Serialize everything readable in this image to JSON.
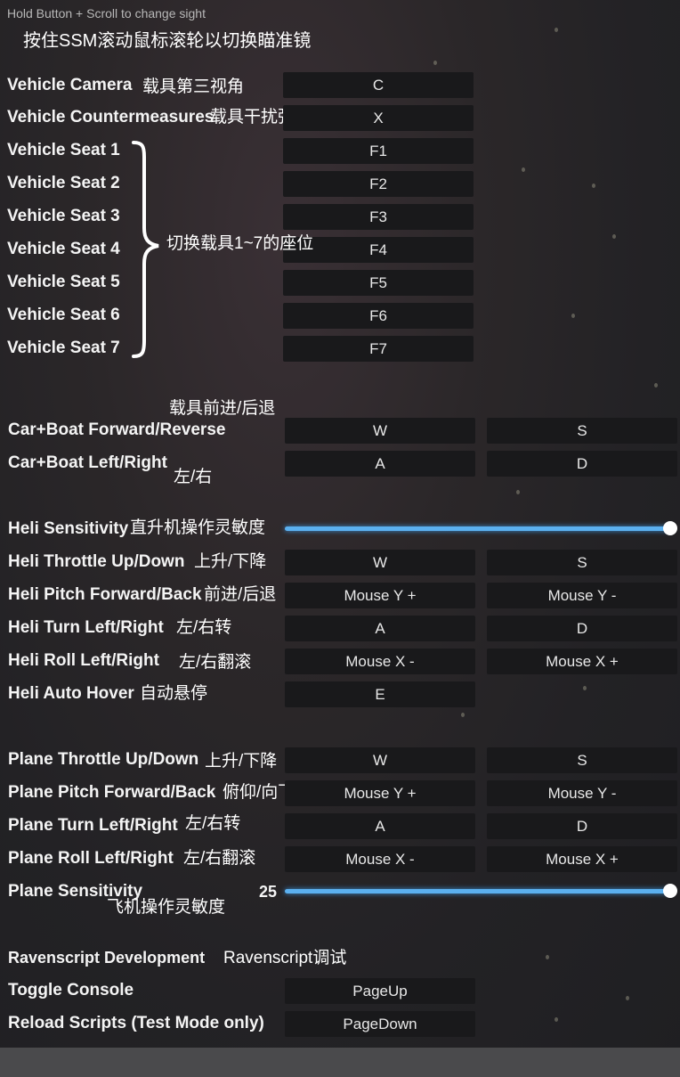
{
  "header": {
    "hint": "Hold Button + Scroll to change sight",
    "note_cn": "按住SSM滚动鼠标滚轮以切换瞄准镜"
  },
  "vehicle": {
    "camera_label": "Vehicle Camera",
    "camera_cn": "载具第三视角",
    "camera_key": "C",
    "counter_label": "Vehicle Countermeasures",
    "counter_cn": "载具干扰弹",
    "counter_key": "X",
    "seats": [
      {
        "label": "Vehicle Seat 1",
        "key": "F1"
      },
      {
        "label": "Vehicle Seat 2",
        "key": "F2"
      },
      {
        "label": "Vehicle Seat 3",
        "key": "F3"
      },
      {
        "label": "Vehicle Seat 4",
        "key": "F4"
      },
      {
        "label": "Vehicle Seat 5",
        "key": "F5"
      },
      {
        "label": "Vehicle Seat 6",
        "key": "F6"
      },
      {
        "label": "Vehicle Seat 7",
        "key": "F7"
      }
    ],
    "seats_cn": "切换载具1~7的座位"
  },
  "car": {
    "section_cn": "载具前进/后退",
    "forward_label": "Car+Boat Forward/Reverse",
    "forward_key1": "W",
    "forward_key2": "S",
    "left_label": "Car+Boat Left/Right",
    "left_cn": "左/右",
    "left_key1": "A",
    "left_key2": "D"
  },
  "heli": {
    "sensitivity_label": "Heli Sensitivity",
    "sensitivity_cn": "直升机操作灵敏度",
    "sensitivity_level": 1.0,
    "throttle_label": "Heli Throttle Up/Down",
    "throttle_cn": "上升/下降",
    "throttle_key1": "W",
    "throttle_key2": "S",
    "pitch_label": "Heli Pitch Forward/Back",
    "pitch_cn": "前进/后退",
    "pitch_key1": "Mouse Y +",
    "pitch_key2": "Mouse Y -",
    "turn_label": "Heli Turn Left/Right",
    "turn_cn": "左/右转",
    "turn_key1": "A",
    "turn_key2": "D",
    "roll_label": "Heli Roll Left/Right",
    "roll_cn": "左/右翻滚",
    "roll_key1": "Mouse X -",
    "roll_key2": "Mouse X +",
    "hover_label": "Heli Auto Hover",
    "hover_cn": "自动悬停",
    "hover_key": "E"
  },
  "plane": {
    "throttle_label": "Plane Throttle Up/Down",
    "throttle_cn": "上升/下降",
    "throttle_key1": "W",
    "throttle_key2": "S",
    "pitch_label": "Plane Pitch Forward/Back",
    "pitch_cn": "俯仰/向下",
    "pitch_key1": "Mouse Y +",
    "pitch_key2": "Mouse Y -",
    "turn_label": "Plane Turn Left/Right",
    "turn_cn": "左/右转",
    "turn_key1": "A",
    "turn_key2": "D",
    "roll_label": "Plane Roll Left/Right",
    "roll_cn": "左/右翻滚",
    "roll_key1": "Mouse X -",
    "roll_key2": "Mouse X +",
    "sensitivity_label": "Plane Sensitivity",
    "sensitivity_cn": "飞机操作灵敏度",
    "sensitivity_value": "25",
    "sensitivity_level": 1.0
  },
  "ravenscript": {
    "section_label": "Ravenscript Development",
    "section_cn": "Ravenscript调试",
    "console_label": "Toggle Console",
    "console_key": "PageUp",
    "reload_label": "Reload Scripts (Test Mode only)",
    "reload_key": "PageDown"
  },
  "colors": {
    "slider_accent": "#5bb0ef",
    "key_background": "#19191b"
  }
}
